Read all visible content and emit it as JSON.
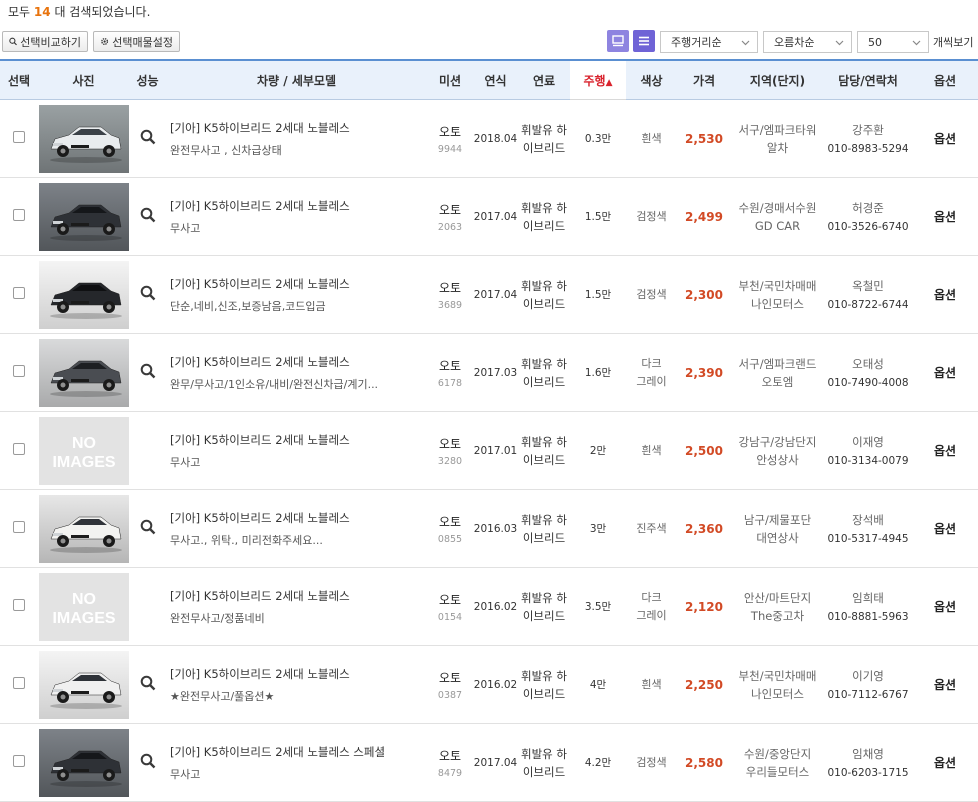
{
  "summary": {
    "prefix": "모두",
    "count": "14",
    "suffix": "대 검색되었습니다."
  },
  "toolbar": {
    "compare_label": "선택비교하기",
    "settings_label": "선택매물설정",
    "sort_select": "주행거리순",
    "order_select": "오름차순",
    "page_size": "50",
    "view_count_label": "개씩보기"
  },
  "columns": [
    "선택",
    "사진",
    "성능",
    "차량 / 세부모델",
    "미션",
    "연식",
    "연료",
    "주행",
    "색상",
    "가격",
    "지역(단지)",
    "담당/연락처",
    "옵션"
  ],
  "sort_arrow": "▲",
  "colors": {
    "accent": "#6f63d6",
    "price": "#d24a25",
    "sort": "#d9232d",
    "header_bg": "#e9f1fb"
  },
  "rows": [
    {
      "title": "[기아] K5하이브리드 2세대 노블레스",
      "desc": "완전무사고 , 신차급상태",
      "mission": "오토",
      "code": "9944",
      "year": "2018.04",
      "fuel1": "휘발유 하",
      "fuel2": "이브리드",
      "km": "0.3만",
      "color1": "흰색",
      "color2": "",
      "price": "2,530",
      "region1": "서구/엠파크타워",
      "region2": "알차",
      "dealer": "강주환",
      "phone": "010-8983-5294",
      "option": "옵션",
      "photo": "white"
    },
    {
      "title": "[기아] K5하이브리드 2세대 노블레스",
      "desc": "무사고",
      "mission": "오토",
      "code": "2063",
      "year": "2017.04",
      "fuel1": "휘발유 하",
      "fuel2": "이브리드",
      "km": "1.5만",
      "color1": "검정색",
      "color2": "",
      "price": "2,499",
      "region1": "수원/경매서수원",
      "region2": "GD CAR",
      "dealer": "허경준",
      "phone": "010-3526-6740",
      "option": "옵션",
      "photo": "black"
    },
    {
      "title": "[기아] K5하이브리드 2세대 노블레스",
      "desc": "단순,네비,신조,보증남음,코드입금",
      "mission": "오토",
      "code": "3689",
      "year": "2017.04",
      "fuel1": "휘발유 하",
      "fuel2": "이브리드",
      "km": "1.5만",
      "color1": "검정색",
      "color2": "",
      "price": "2,300",
      "region1": "부천/국민차매매",
      "region2": "나인모터스",
      "dealer": "옥철민",
      "phone": "010-8722-6744",
      "option": "옵션",
      "photo": "black-studio"
    },
    {
      "title": "[기아] K5하이브리드 2세대 노블레스",
      "desc": "완무/무사고/1인소유/내비/완전신차급/계기...",
      "mission": "오토",
      "code": "6178",
      "year": "2017.03",
      "fuel1": "휘발유 하",
      "fuel2": "이브리드",
      "km": "1.6만",
      "color1": "다크",
      "color2": "그레이",
      "price": "2,390",
      "region1": "서구/엠파크랜드",
      "region2": "오토엠",
      "dealer": "오태성",
      "phone": "010-7490-4008",
      "option": "옵션",
      "photo": "gray"
    },
    {
      "title": "[기아] K5하이브리드 2세대 노블레스",
      "desc": "무사고",
      "mission": "오토",
      "code": "3280",
      "year": "2017.01",
      "fuel1": "휘발유 하",
      "fuel2": "이브리드",
      "km": "2만",
      "color1": "흰색",
      "color2": "",
      "price": "2,500",
      "region1": "강남구/강남단지",
      "region2": "안성상사",
      "dealer": "이재영",
      "phone": "010-3134-0079",
      "option": "옵션",
      "photo": "none"
    },
    {
      "title": "[기아] K5하이브리드 2세대 노블레스",
      "desc": "무사고., 위탁., 미리전화주세요...",
      "mission": "오토",
      "code": "0855",
      "year": "2016.03",
      "fuel1": "휘발유 하",
      "fuel2": "이브리드",
      "km": "3만",
      "color1": "진주색",
      "color2": "",
      "price": "2,360",
      "region1": "남구/제물포단",
      "region2": "대연상사",
      "dealer": "장석배",
      "phone": "010-5317-4945",
      "option": "옵션",
      "photo": "pearl"
    },
    {
      "title": "[기아] K5하이브리드 2세대 노블레스",
      "desc": "완전무사고/정품네비",
      "mission": "오토",
      "code": "0154",
      "year": "2016.02",
      "fuel1": "휘발유 하",
      "fuel2": "이브리드",
      "km": "3.5만",
      "color1": "다크",
      "color2": "그레이",
      "price": "2,120",
      "region1": "안산/마트단지",
      "region2": "The중고차",
      "dealer": "임희태",
      "phone": "010-8881-5963",
      "option": "옵션",
      "photo": "none"
    },
    {
      "title": "[기아] K5하이브리드 2세대 노블레스",
      "desc": "★완전무사고/풀옵션★",
      "mission": "오토",
      "code": "0387",
      "year": "2016.02",
      "fuel1": "휘발유 하",
      "fuel2": "이브리드",
      "km": "4만",
      "color1": "흰색",
      "color2": "",
      "price": "2,250",
      "region1": "부천/국민차매매",
      "region2": "나인모터스",
      "dealer": "이기영",
      "phone": "010-7112-6767",
      "option": "옵션",
      "photo": "white-studio"
    },
    {
      "title": "[기아] K5하이브리드 2세대 노블레스 스페셜",
      "desc": "무사고",
      "mission": "오토",
      "code": "8479",
      "year": "2017.04",
      "fuel1": "휘발유 하",
      "fuel2": "이브리드",
      "km": "4.2만",
      "color1": "검정색",
      "color2": "",
      "price": "2,580",
      "region1": "수원/중앙단지",
      "region2": "우리들모터스",
      "dealer": "임채영",
      "phone": "010-6203-1715",
      "option": "옵션",
      "photo": "black"
    }
  ],
  "no_image_line1": "NO",
  "no_image_line2": "IMAGES"
}
